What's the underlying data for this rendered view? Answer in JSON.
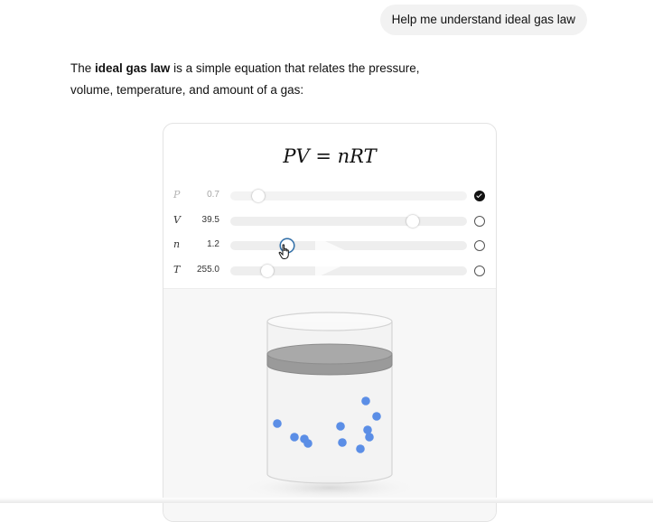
{
  "user_message": {
    "text": "Help me understand ideal gas law"
  },
  "assistant_reply": {
    "intro": "The ",
    "term": "ideal gas law",
    "line1_rest": " is a simple equation that relates the pressure,",
    "line2": "volume, temperature, and amount of a gas:"
  },
  "widget": {
    "equation": "PV = nRT",
    "variables": [
      {
        "symbol": "P",
        "value": "0.7",
        "level": 0.12,
        "solved_for": true
      },
      {
        "symbol": "V",
        "value": "39.5",
        "level": 0.77,
        "solved_for": false
      },
      {
        "symbol": "n",
        "value": "1.2",
        "level": 0.24,
        "solved_for": false
      },
      {
        "symbol": "T",
        "value": "255.0",
        "level": 0.155,
        "solved_for": false
      }
    ],
    "particle_color": "#5b8ee6",
    "particle_count": 11,
    "piston_color": "#9a9a9a"
  }
}
